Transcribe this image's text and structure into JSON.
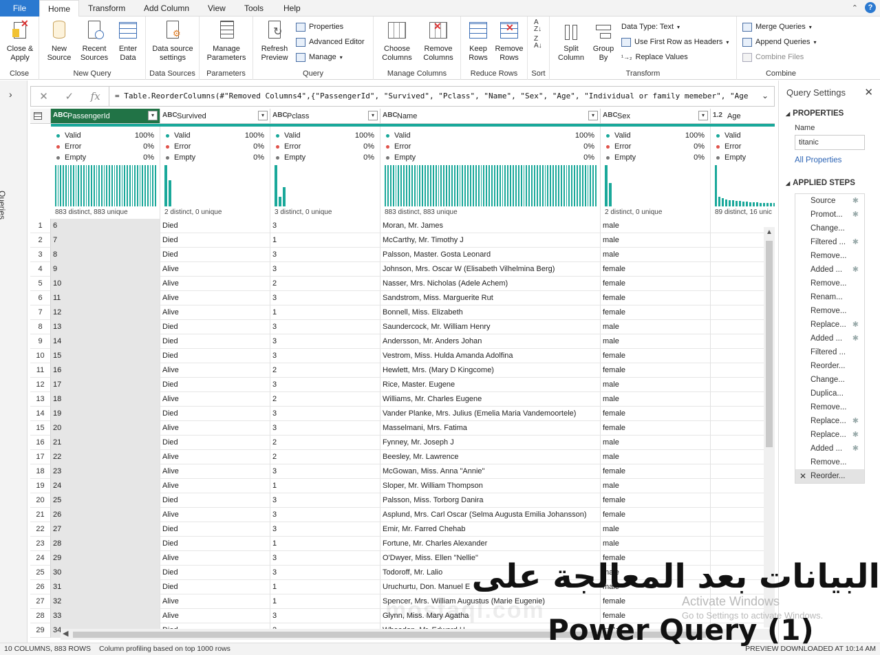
{
  "tabs": [
    {
      "label": "File"
    },
    {
      "label": "Home"
    },
    {
      "label": "Transform"
    },
    {
      "label": "Add Column"
    },
    {
      "label": "View"
    },
    {
      "label": "Tools"
    },
    {
      "label": "Help"
    }
  ],
  "ribbon": {
    "close": {
      "label": "Close",
      "close_apply": "Close &\nApply"
    },
    "new_query": {
      "label": "New Query",
      "new_source": "New\nSource",
      "recent_sources": "Recent\nSources",
      "enter_data": "Enter\nData"
    },
    "data_sources": {
      "label": "Data Sources",
      "settings": "Data source\nsettings"
    },
    "parameters": {
      "label": "Parameters",
      "manage": "Manage\nParameters"
    },
    "query": {
      "label": "Query",
      "refresh": "Refresh\nPreview",
      "properties": "Properties",
      "advanced_editor": "Advanced Editor",
      "manage": "Manage"
    },
    "manage_columns": {
      "label": "Manage Columns",
      "choose": "Choose\nColumns",
      "remove": "Remove\nColumns"
    },
    "reduce_rows": {
      "label": "Reduce Rows",
      "keep": "Keep\nRows",
      "remove": "Remove\nRows"
    },
    "sort": {
      "label": "Sort"
    },
    "transform": {
      "label": "Transform",
      "split": "Split\nColumn",
      "group": "Group\nBy",
      "data_type": "Data Type: Text",
      "first_row": "Use First Row as Headers",
      "replace": "Replace Values"
    },
    "combine": {
      "label": "Combine",
      "merge": "Merge Queries",
      "append": "Append Queries",
      "combine_files": "Combine Files"
    }
  },
  "queries_label": "Queries",
  "formula": "= Table.ReorderColumns(#\"Removed Columns4\",{\"PassengerId\", \"Survived\", \"Pclass\", \"Name\", \"Sex\", \"Age\", \"Individual or family memeber\", \"Age",
  "columns": [
    {
      "type": "ABC",
      "name": "PassengerId",
      "distinct": "883 distinct, 883 unique"
    },
    {
      "type": "ABC",
      "name": "Survived",
      "distinct": "2 distinct, 0 unique"
    },
    {
      "type": "ABC",
      "name": "Pclass",
      "distinct": "3 distinct, 0 unique"
    },
    {
      "type": "ABC",
      "name": "Name",
      "distinct": "883 distinct, 883 unique"
    },
    {
      "type": "ABC",
      "name": "Sex",
      "distinct": "2 distinct, 0 unique"
    },
    {
      "type": "1.2",
      "name": "Age",
      "distinct": "89 distinct, 16 unic"
    }
  ],
  "profile_labels": {
    "valid": "Valid",
    "error": "Error",
    "empty": "Empty",
    "p100": "100%",
    "p0": "0%"
  },
  "profile_colors": {
    "valid": "#1aa89a",
    "error": "#e0524a",
    "empty": "#777777"
  },
  "rows": [
    [
      "1",
      "6",
      "Died",
      "3",
      "Moran, Mr. James",
      "male"
    ],
    [
      "2",
      "7",
      "Died",
      "1",
      "McCarthy, Mr. Timothy J",
      "male"
    ],
    [
      "3",
      "8",
      "Died",
      "3",
      "Palsson, Master. Gosta Leonard",
      "male"
    ],
    [
      "4",
      "9",
      "Alive",
      "3",
      "Johnson, Mrs. Oscar W (Elisabeth Vilhelmina Berg)",
      "female"
    ],
    [
      "5",
      "10",
      "Alive",
      "2",
      "Nasser, Mrs. Nicholas (Adele Achem)",
      "female"
    ],
    [
      "6",
      "11",
      "Alive",
      "3",
      "Sandstrom, Miss. Marguerite Rut",
      "female"
    ],
    [
      "7",
      "12",
      "Alive",
      "1",
      "Bonnell, Miss. Elizabeth",
      "female"
    ],
    [
      "8",
      "13",
      "Died",
      "3",
      "Saundercock, Mr. William Henry",
      "male"
    ],
    [
      "9",
      "14",
      "Died",
      "3",
      "Andersson, Mr. Anders Johan",
      "male"
    ],
    [
      "10",
      "15",
      "Died",
      "3",
      "Vestrom, Miss. Hulda Amanda Adolfina",
      "female"
    ],
    [
      "11",
      "16",
      "Alive",
      "2",
      "Hewlett, Mrs. (Mary D Kingcome)",
      "female"
    ],
    [
      "12",
      "17",
      "Died",
      "3",
      "Rice, Master. Eugene",
      "male"
    ],
    [
      "13",
      "18",
      "Alive",
      "2",
      "Williams, Mr. Charles Eugene",
      "male"
    ],
    [
      "14",
      "19",
      "Died",
      "3",
      "Vander Planke, Mrs. Julius (Emelia Maria Vandemoortele)",
      "female"
    ],
    [
      "15",
      "20",
      "Alive",
      "3",
      "Masselmani, Mrs. Fatima",
      "female"
    ],
    [
      "16",
      "21",
      "Died",
      "2",
      "Fynney, Mr. Joseph J",
      "male"
    ],
    [
      "17",
      "22",
      "Alive",
      "2",
      "Beesley, Mr. Lawrence",
      "male"
    ],
    [
      "18",
      "23",
      "Alive",
      "3",
      "McGowan, Miss. Anna \"Annie\"",
      "female"
    ],
    [
      "19",
      "24",
      "Alive",
      "1",
      "Sloper, Mr. William Thompson",
      "male"
    ],
    [
      "20",
      "25",
      "Died",
      "3",
      "Palsson, Miss. Torborg Danira",
      "female"
    ],
    [
      "21",
      "26",
      "Alive",
      "3",
      "Asplund, Mrs. Carl Oscar (Selma Augusta Emilia Johansson)",
      "female"
    ],
    [
      "22",
      "27",
      "Died",
      "3",
      "Emir, Mr. Farred Chehab",
      "male"
    ],
    [
      "23",
      "28",
      "Died",
      "1",
      "Fortune, Mr. Charles Alexander",
      "male"
    ],
    [
      "24",
      "29",
      "Alive",
      "3",
      "O'Dwyer, Miss. Ellen \"Nellie\"",
      "female"
    ],
    [
      "25",
      "30",
      "Died",
      "3",
      "Todoroff, Mr. Lalio",
      "male"
    ],
    [
      "26",
      "31",
      "Died",
      "1",
      "Uruchurtu, Don. Manuel E",
      "male"
    ],
    [
      "27",
      "32",
      "Alive",
      "1",
      "Spencer, Mrs. William Augustus (Marie Eugenie)",
      "female"
    ],
    [
      "28",
      "33",
      "Alive",
      "3",
      "Glynn, Miss. Mary Agatha",
      "female"
    ],
    [
      "29",
      "34",
      "Died",
      "2",
      "Wheadon, Mr. Edward H",
      "male"
    ]
  ],
  "settings": {
    "title": "Query Settings",
    "properties": "PROPERTIES",
    "name_label": "Name",
    "name_value": "titanic",
    "all_properties": "All Properties",
    "applied_steps": "APPLIED STEPS",
    "steps": [
      {
        "label": "Source",
        "gear": true
      },
      {
        "label": "Promot...",
        "gear": true
      },
      {
        "label": "Change...",
        "gear": false
      },
      {
        "label": "Filtered ...",
        "gear": true
      },
      {
        "label": "Remove...",
        "gear": false
      },
      {
        "label": "Added ...",
        "gear": true
      },
      {
        "label": "Remove...",
        "gear": false
      },
      {
        "label": "Renam...",
        "gear": false
      },
      {
        "label": "Remove...",
        "gear": false
      },
      {
        "label": "Replace...",
        "gear": true
      },
      {
        "label": "Added ...",
        "gear": true
      },
      {
        "label": "Filtered ...",
        "gear": false
      },
      {
        "label": "Reorder...",
        "gear": false
      },
      {
        "label": "Change...",
        "gear": false
      },
      {
        "label": "Duplica...",
        "gear": false
      },
      {
        "label": "Remove...",
        "gear": false
      },
      {
        "label": "Replace...",
        "gear": true
      },
      {
        "label": "Replace...",
        "gear": true
      },
      {
        "label": "Added ...",
        "gear": true
      },
      {
        "label": "Remove...",
        "gear": false
      },
      {
        "label": "Reorder...",
        "gear": false,
        "current": true
      }
    ]
  },
  "status": {
    "columns": "10 COLUMNS, 883 ROWS",
    "profiling": "Column profiling based on top 1000 rows",
    "preview": "PREVIEW DOWNLOADED AT 10:14 AM"
  },
  "activate": {
    "line1": "Activate Windows",
    "line2": "Go to Settings to activate Windows."
  },
  "overlay": {
    "arabic": "البيانات بعد المعالجة على",
    "english": "Power Query (1)"
  },
  "watermark": "mostaql.com"
}
